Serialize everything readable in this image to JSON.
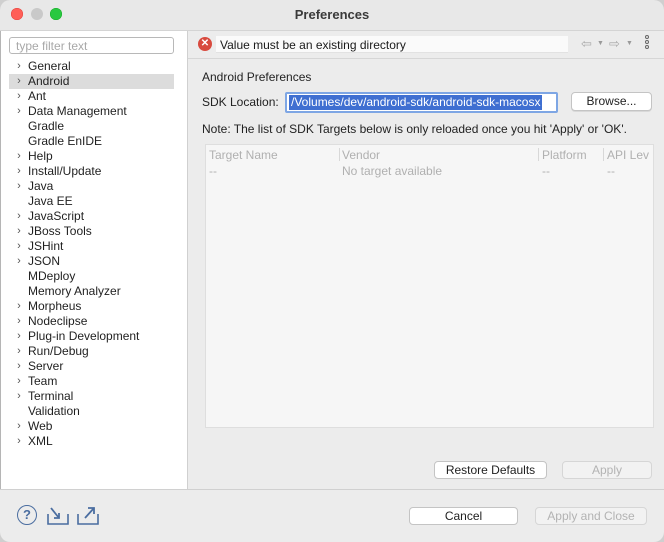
{
  "window": {
    "title": "Preferences"
  },
  "filter": {
    "placeholder": "type filter text",
    "value": ""
  },
  "tree": [
    {
      "label": "General",
      "expandable": true
    },
    {
      "label": "Android",
      "expandable": true,
      "selected": true
    },
    {
      "label": "Ant",
      "expandable": true
    },
    {
      "label": "Data Management",
      "expandable": true
    },
    {
      "label": "Gradle",
      "expandable": false
    },
    {
      "label": "Gradle EnIDE",
      "expandable": false
    },
    {
      "label": "Help",
      "expandable": true
    },
    {
      "label": "Install/Update",
      "expandable": true
    },
    {
      "label": "Java",
      "expandable": true
    },
    {
      "label": "Java EE",
      "expandable": false
    },
    {
      "label": "JavaScript",
      "expandable": true
    },
    {
      "label": "JBoss Tools",
      "expandable": true
    },
    {
      "label": "JSHint",
      "expandable": true
    },
    {
      "label": "JSON",
      "expandable": true
    },
    {
      "label": "MDeploy",
      "expandable": false
    },
    {
      "label": "Memory Analyzer",
      "expandable": false
    },
    {
      "label": "Morpheus",
      "expandable": true
    },
    {
      "label": "Nodeclipse",
      "expandable": true
    },
    {
      "label": "Plug-in Development",
      "expandable": true
    },
    {
      "label": "Run/Debug",
      "expandable": true
    },
    {
      "label": "Server",
      "expandable": true
    },
    {
      "label": "Team",
      "expandable": true
    },
    {
      "label": "Terminal",
      "expandable": true
    },
    {
      "label": "Validation",
      "expandable": false
    },
    {
      "label": "Web",
      "expandable": true
    },
    {
      "label": "XML",
      "expandable": true
    }
  ],
  "message": {
    "icon": "error-icon",
    "text": "Value must be an existing directory"
  },
  "nav": {
    "back_icon": "back-arrow-icon",
    "forward_icon": "forward-arrow-icon",
    "menu_icon": "more-options-icon"
  },
  "main": {
    "section_title": "Android Preferences",
    "sdk_label": "SDK Location:",
    "sdk_value": "/Volumes/dev/android-sdk/android-sdk-macosx",
    "browse_label": "Browse...",
    "note": "Note: The list of SDK Targets below is only reloaded once you hit 'Apply' or 'OK'.",
    "table": {
      "columns": [
        "Target Name",
        "Vendor",
        "Platform",
        "API Lev"
      ],
      "row": [
        "--",
        "No target available",
        "--",
        "--"
      ]
    },
    "restore_label": "Restore Defaults",
    "apply_label": "Apply"
  },
  "footer": {
    "help_icon": "help-icon",
    "import_icon": "import-icon",
    "export_icon": "export-icon",
    "cancel_label": "Cancel",
    "apply_close_label": "Apply and Close"
  },
  "colors": {
    "error": "#d84a3e",
    "selection": "#3f6fd1",
    "focus_ring": "#7ea6e4",
    "close": "#ff5f57",
    "maximize": "#28c840"
  }
}
